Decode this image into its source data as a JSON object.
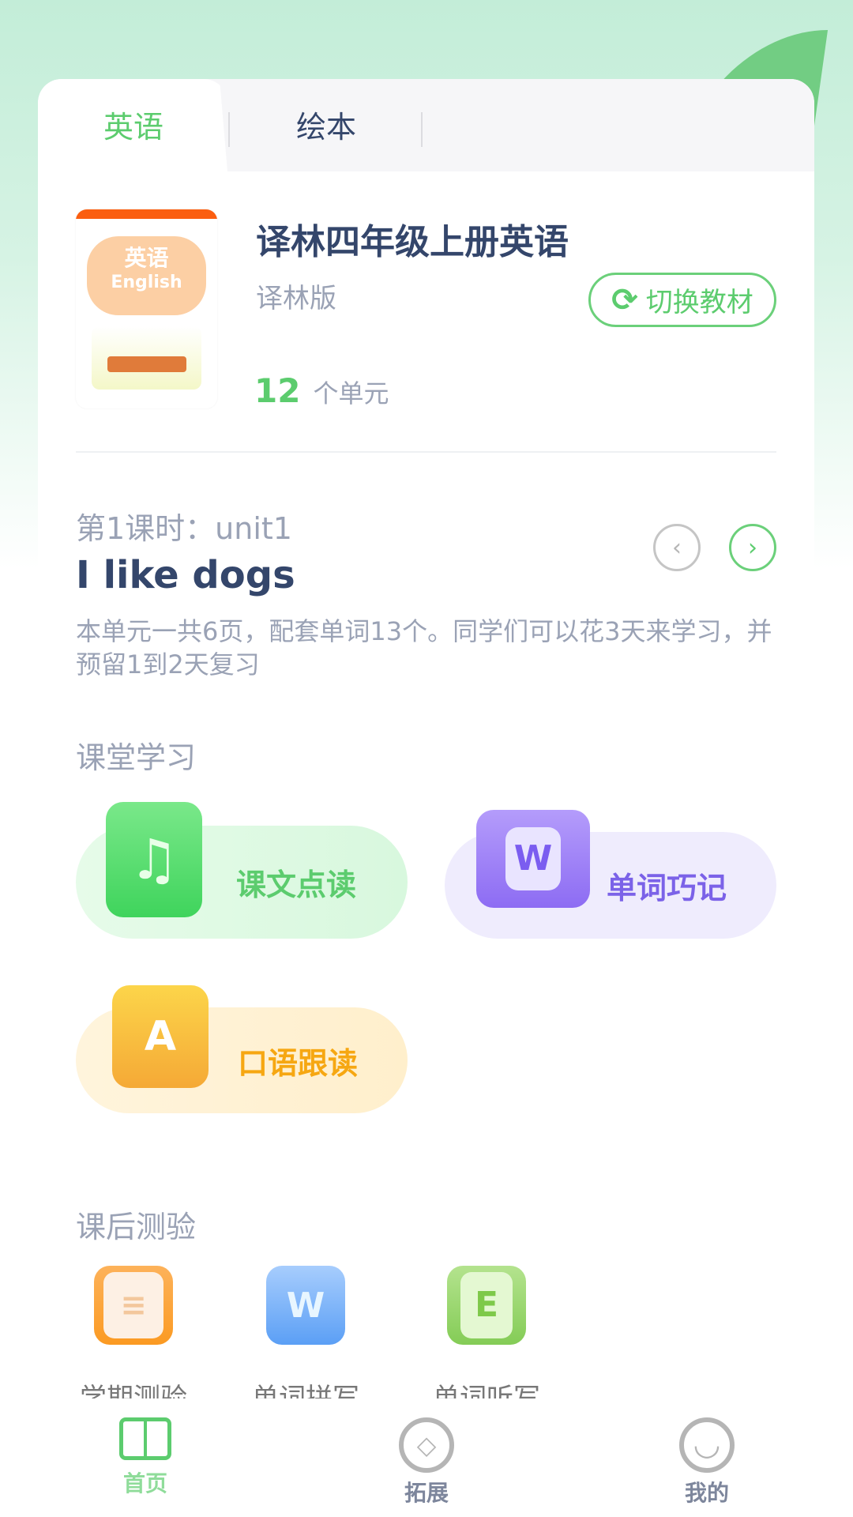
{
  "colors": {
    "accent": "#5ccc6e",
    "title": "#34466b",
    "muted": "#9aa2b5"
  },
  "tabs": [
    {
      "label": "英语",
      "active": true
    },
    {
      "label": "绘本",
      "active": false
    }
  ],
  "book": {
    "cover_title": "英语",
    "cover_subtitle": "English",
    "title": "译林四年级上册英语",
    "edition": "译林版",
    "switch_label": "切换教材",
    "unit_count": "12",
    "unit_suffix": "个单元"
  },
  "lesson": {
    "period": "第1课时：unit1",
    "title": "I like dogs",
    "description": "本单元一共6页，配套单词13个。同学们可以花3天来学习，并预留1到2天复习",
    "prev_icon": "chevron-left-icon",
    "next_icon": "chevron-right-icon"
  },
  "classroom": {
    "heading": "课堂学习",
    "items": [
      {
        "label": "课文点读",
        "icon": "music-book-icon"
      },
      {
        "label": "单词巧记",
        "icon": "word-card-icon"
      },
      {
        "label": "口语跟读",
        "icon": "microphone-a-icon"
      }
    ]
  },
  "quiz": {
    "heading": "课后测验",
    "items": [
      {
        "label": "学期测验",
        "icon": "document-pencil-icon"
      },
      {
        "label": "单词拼写",
        "icon": "w-pencil-icon"
      },
      {
        "label": "单词听写",
        "icon": "e-headphones-icon"
      }
    ]
  },
  "nav": [
    {
      "label": "首页",
      "icon": "book-icon",
      "active": true
    },
    {
      "label": "拓展",
      "icon": "compass-icon",
      "active": false
    },
    {
      "label": "我的",
      "icon": "smiley-icon",
      "active": false
    }
  ]
}
